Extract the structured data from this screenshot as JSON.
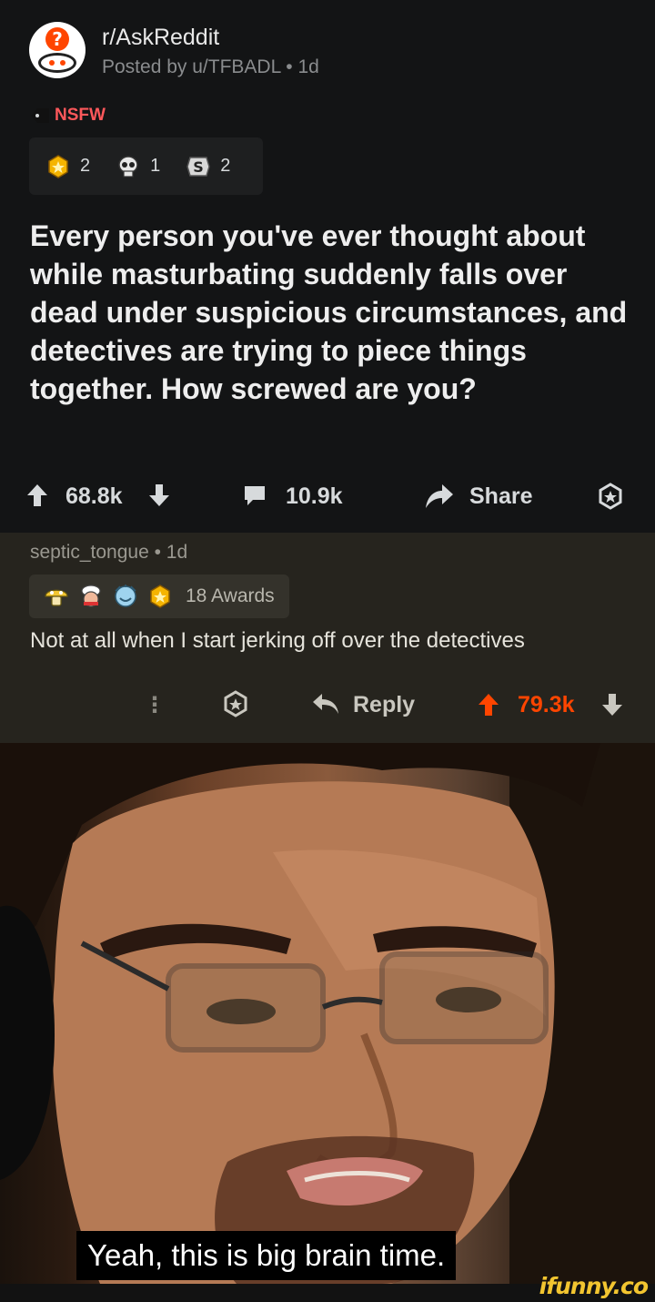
{
  "post": {
    "subreddit": "r/AskReddit",
    "posted_by": "Posted by u/TFBADL • 1d",
    "nsfw_label": "NSFW",
    "awards": [
      {
        "icon": "gold-star-award-icon",
        "count": "2"
      },
      {
        "icon": "skull-award-icon",
        "count": "1"
      },
      {
        "icon": "silver-s-award-icon",
        "count": "2"
      }
    ],
    "title": "Every person you've ever thought about while masturbating suddenly falls over dead under suspicious circumstances, and detectives are trying to piece things together. How screwed are you?",
    "score": "68.8k",
    "comments": "10.9k",
    "share_label": "Share"
  },
  "comment": {
    "author_line": "septic_tongue • 1d",
    "awards_label": "18 Awards",
    "award_icons": [
      "mushroom-award-icon",
      "chef-award-icon",
      "blue-face-award-icon",
      "gold-star-award-icon"
    ],
    "body": "Not at all when I start jerking off over the detectives",
    "more_label": "⋮",
    "reply_label": "Reply",
    "score": "79.3k"
  },
  "meme": {
    "subtitle": "Yeah, this is big brain time."
  },
  "watermark": "ifunny.co",
  "colors": {
    "background": "#131415",
    "comment_background": "#26241e",
    "upvote_orange": "#ff4500",
    "nsfw_red": "#ff585b",
    "watermark_yellow": "#f2c530"
  }
}
